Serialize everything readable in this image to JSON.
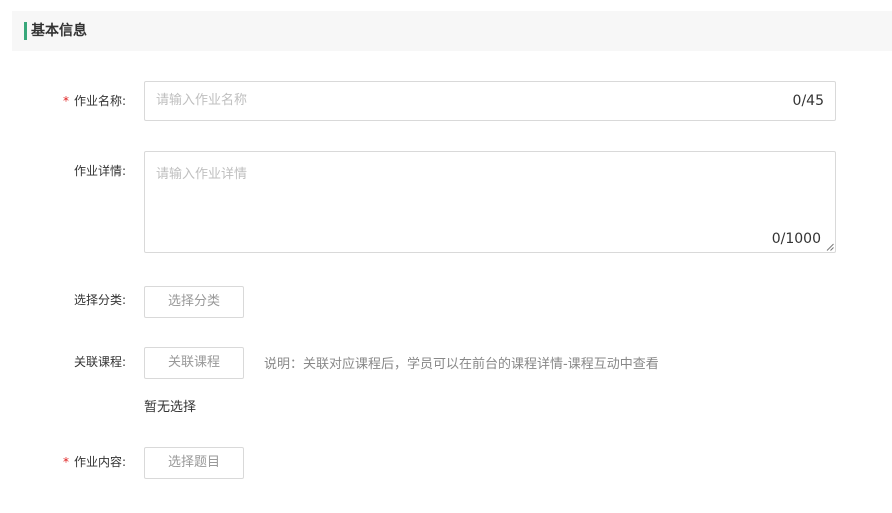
{
  "section": {
    "title": "基本信息",
    "accent_color": "#38a77a"
  },
  "fields": {
    "name": {
      "required_mark": "*",
      "label": "作业名称:",
      "placeholder": "请输入作业名称",
      "value": "",
      "counter": "0/45"
    },
    "detail": {
      "label": "作业详情:",
      "placeholder": "请输入作业详情",
      "value": "",
      "counter": "0/1000"
    },
    "category": {
      "label": "选择分类:",
      "button_label": "选择分类"
    },
    "course": {
      "label": "关联课程:",
      "button_label": "关联课程",
      "hint": "说明：关联对应课程后，学员可以在前台的课程详情-课程互动中查看",
      "empty_text": "暂无选择"
    },
    "content": {
      "required_mark": "*",
      "label": "作业内容:",
      "button_label": "选择题目"
    }
  },
  "colors": {
    "required": "#e02020",
    "border": "#d9d9d9",
    "placeholder": "#bfbfbf",
    "header_bg": "#f7f7f7"
  }
}
